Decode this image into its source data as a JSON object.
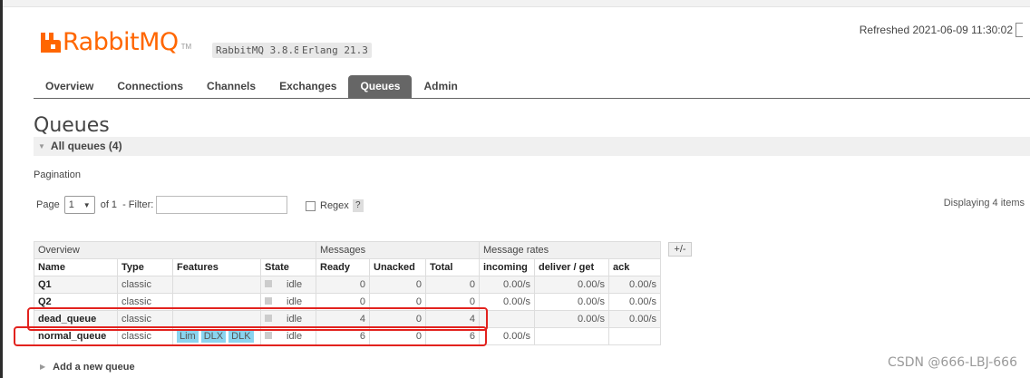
{
  "app": {
    "logo_text": "RabbitMQ",
    "logo_tm": "TM",
    "rabbitmq_version": "RabbitMQ 3.8.8",
    "erlang_version": "Erlang 21.3",
    "refreshed": "Refreshed 2021-06-09 11:30:02"
  },
  "tabs": [
    {
      "label": "Overview"
    },
    {
      "label": "Connections"
    },
    {
      "label": "Channels"
    },
    {
      "label": "Exchanges"
    },
    {
      "label": "Queues",
      "active": true
    },
    {
      "label": "Admin"
    }
  ],
  "page_title": "Queues",
  "section_title": "All queues (4)",
  "pagination": {
    "label": "Pagination",
    "page_label": "Page",
    "page_value": "1",
    "of_label": "of 1",
    "filter_label": "- Filter:",
    "filter_value": "",
    "regex_label": "Regex",
    "help_label": "?",
    "displaying": "Displaying 4 items"
  },
  "table": {
    "groups": [
      "Overview",
      "Messages",
      "Message rates"
    ],
    "plus_minus": "+/-",
    "columns": [
      "Name",
      "Type",
      "Features",
      "State",
      "Ready",
      "Unacked",
      "Total",
      "incoming",
      "deliver / get",
      "ack"
    ],
    "rows": [
      {
        "name": "Q1",
        "type": "classic",
        "features": [],
        "state": "idle",
        "ready": "0",
        "unacked": "0",
        "total": "0",
        "incoming": "0.00/s",
        "deliver_get": "0.00/s",
        "ack": "0.00/s"
      },
      {
        "name": "Q2",
        "type": "classic",
        "features": [],
        "state": "idle",
        "ready": "0",
        "unacked": "0",
        "total": "0",
        "incoming": "0.00/s",
        "deliver_get": "0.00/s",
        "ack": "0.00/s"
      },
      {
        "name": "dead_queue",
        "type": "classic",
        "features": [],
        "state": "idle",
        "ready": "4",
        "unacked": "0",
        "total": "4",
        "incoming": "",
        "deliver_get": "0.00/s",
        "ack": "0.00/s"
      },
      {
        "name": "normal_queue",
        "type": "classic",
        "features": [
          "Lim",
          "DLX",
          "DLK"
        ],
        "state": "idle",
        "ready": "6",
        "unacked": "0",
        "total": "6",
        "incoming": "0.00/s",
        "deliver_get": "",
        "ack": ""
      }
    ]
  },
  "add_queue": "Add a new queue",
  "watermark": "CSDN @666-LBJ-666",
  "colors": {
    "brand": "#ff6600",
    "active_tab": "#666666",
    "feature_tag": "#8ad4ef",
    "highlight": "#e2221e"
  }
}
